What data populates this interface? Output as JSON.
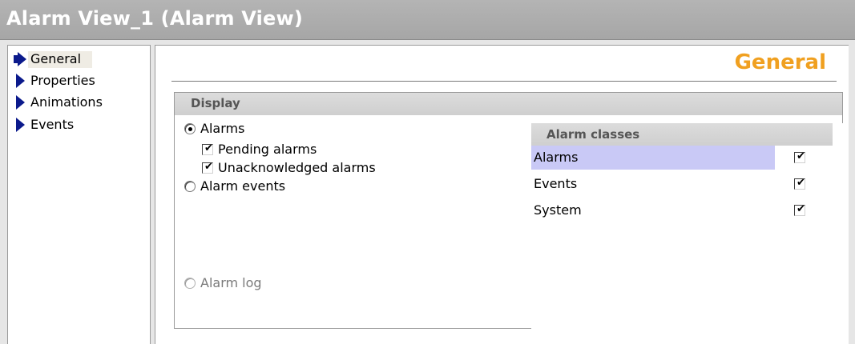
{
  "window": {
    "title": "Alarm View_1 (Alarm View)"
  },
  "nav": {
    "items": [
      {
        "label": "General",
        "selected": true
      },
      {
        "label": "Properties",
        "selected": false
      },
      {
        "label": "Animations",
        "selected": false
      },
      {
        "label": "Events",
        "selected": false
      }
    ]
  },
  "main": {
    "heading": "General",
    "display": {
      "title": "Display",
      "alarms_option": {
        "label": "Alarms",
        "selected": true
      },
      "pending_alarms": {
        "label": "Pending alarms",
        "checked": true
      },
      "unacknowledged_alarms": {
        "label": "Unacknowledged alarms",
        "checked": true
      },
      "alarm_events_option": {
        "label": "Alarm events",
        "selected": false
      },
      "alarm_log_option": {
        "label": "Alarm log",
        "selected": false,
        "enabled": false
      }
    },
    "alarm_classes": {
      "header": "Alarm classes",
      "rows": [
        {
          "name": "Alarms",
          "checked": true,
          "selected": true
        },
        {
          "name": "Events",
          "checked": true,
          "selected": false
        },
        {
          "name": "System",
          "checked": true,
          "selected": false
        }
      ]
    }
  },
  "colors": {
    "heading": "#f0a020",
    "nav_arrow": "#0b1a8c",
    "row_selected": "#c9c9f6",
    "titlebar": "#aeaeae"
  },
  "icons": {
    "checkmark": "✔",
    "nav_arrow": "triangle-right"
  }
}
